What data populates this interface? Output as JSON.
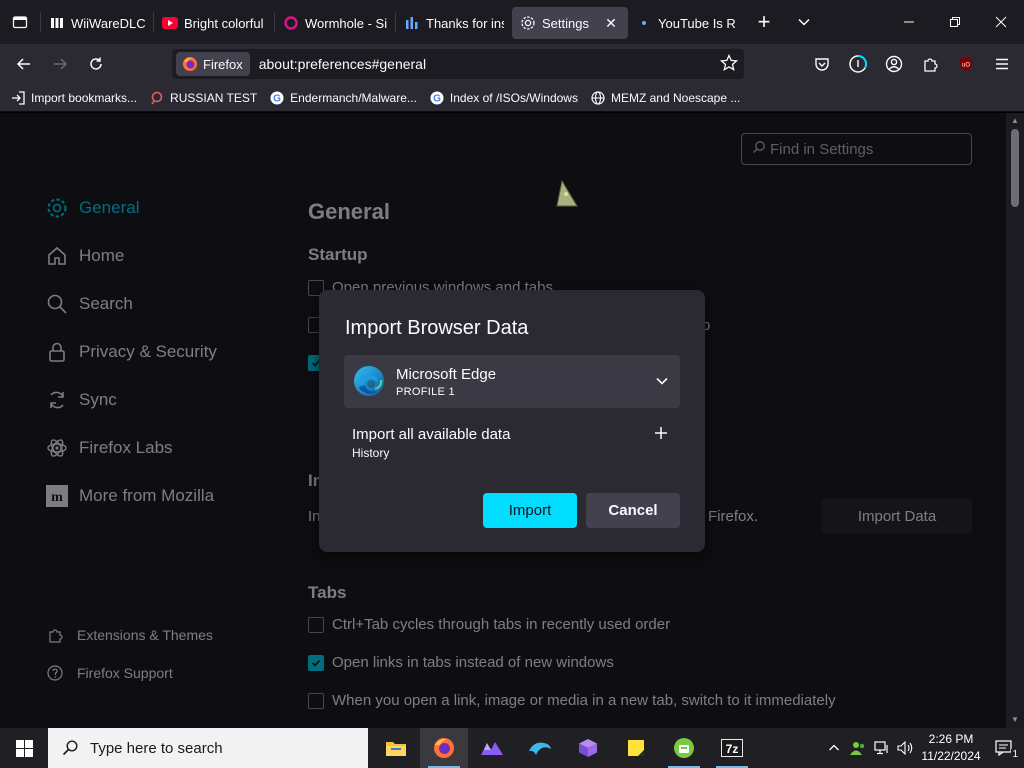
{
  "tabs": [
    {
      "title": "WiiWareDLCVi",
      "icon": "wiiware-favicon"
    },
    {
      "title": "Bright colorful",
      "icon": "youtube-favicon"
    },
    {
      "title": "Wormhole - Si",
      "icon": "wormhole-favicon"
    },
    {
      "title": "Thanks for inst",
      "icon": "chart-favicon"
    },
    {
      "title": "Settings",
      "icon": "gear-icon",
      "active": true
    },
    {
      "title": "YouTube Is Rai",
      "icon": "dot-favicon"
    }
  ],
  "navbar": {
    "identity_label": "Firefox",
    "url": "about:preferences#general"
  },
  "bookmarks": [
    {
      "label": "Import bookmarks...",
      "icon": "import-icon"
    },
    {
      "label": "RUSSIAN TEST",
      "icon": "magnifier-favicon"
    },
    {
      "label": "Endermanch/Malware...",
      "icon": "google-favicon"
    },
    {
      "label": "Index of /ISOs/Windows",
      "icon": "google-favicon"
    },
    {
      "label": "MEMZ and Noescape ...",
      "icon": "globe-icon"
    }
  ],
  "settings": {
    "find_placeholder": "Find in Settings",
    "categories": [
      {
        "label": "General",
        "icon": "gear-icon",
        "selected": true
      },
      {
        "label": "Home",
        "icon": "home-icon"
      },
      {
        "label": "Search",
        "icon": "search-icon"
      },
      {
        "label": "Privacy & Security",
        "icon": "lock-icon"
      },
      {
        "label": "Sync",
        "icon": "sync-icon"
      },
      {
        "label": "Firefox Labs",
        "icon": "labs-icon"
      },
      {
        "label": "More from Mozilla",
        "icon": "mozilla-icon"
      }
    ],
    "footer_links": [
      {
        "label": "Extensions & Themes",
        "icon": "puzzle-icon"
      },
      {
        "label": "Firefox Support",
        "icon": "help-icon"
      }
    ],
    "page_title": "General",
    "startup_heading": "Startup",
    "startup_partial_text": "Open previous windows and tabs",
    "startup_partial_text_2": "o",
    "import_heading_partial": "Im",
    "import_desc_partial": "In",
    "import_desc_end": "Firefox.",
    "import_data_button": "Import Data",
    "tabs_heading": "Tabs",
    "tabs_options": [
      {
        "label": "Ctrl+Tab cycles through tabs in recently used order",
        "checked": false
      },
      {
        "label": "Open links in tabs instead of new windows",
        "checked": true
      },
      {
        "label": "When you open a link, image or media in a new tab, switch to it immediately",
        "checked": false
      }
    ]
  },
  "dialog": {
    "title": "Import Browser Data",
    "browser_name": "Microsoft Edge",
    "profile": "PROFILE 1",
    "import_all_label": "Import all available data",
    "data_types": "History",
    "import_button": "Import",
    "cancel_button": "Cancel"
  },
  "taskbar": {
    "search_placeholder": "Type here to search",
    "time": "2:26 PM",
    "date": "11/22/2024",
    "notification_count": "1"
  },
  "colors": {
    "accent": "#00ddff",
    "dialog_bg": "#2b2a33",
    "page_bg": "#1c1b22"
  }
}
